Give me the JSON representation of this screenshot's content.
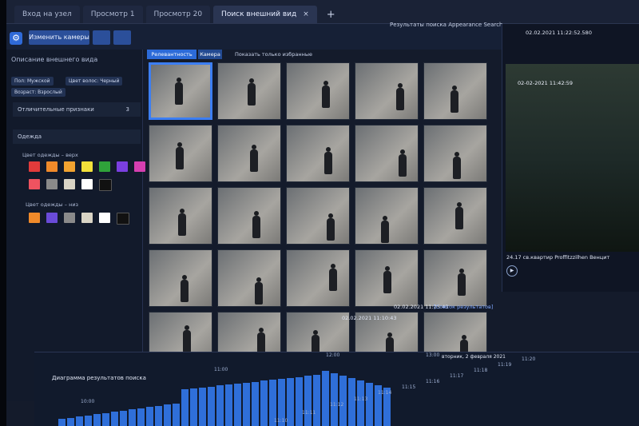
{
  "tabs": [
    {
      "label": "Вход на узел"
    },
    {
      "label": "Просмотр 1"
    },
    {
      "label": "Просмотр 20"
    },
    {
      "label": "Поиск внешний вид",
      "active": true
    }
  ],
  "tab_close": "×",
  "tab_add": "+",
  "toolbar": {
    "change_camera": "Изменить камеры"
  },
  "results_title": "Результаты поиска Appearance Search",
  "left": {
    "appearance_title": "Описание внешнего вида",
    "chips": [
      "Пол: Мужской",
      "Цвет волос: Черный",
      "Возраст: Взрослый"
    ],
    "distinct_features": "Отличительные признаки",
    "distinct_count": "3",
    "clothing": "Одежда",
    "top_color": "Цвет одежды – верх",
    "bottom_color": "Цвет одежды – низ",
    "top_colors": [
      "#e23b3b",
      "#f08a2a",
      "#f2a330",
      "#f2e03a",
      "#2fa33a",
      "#7a3fe0",
      "#d53fb0",
      "#ef5360",
      "#8a8a8a",
      "#d9d4c5",
      "#ffffff",
      "#111111"
    ],
    "bottom_colors": [
      "#f08a2a",
      "#6a4bd8",
      "#8a8a8a",
      "#d9d4c5",
      "#ffffff",
      "#111111"
    ]
  },
  "filters": {
    "relevance": "Релевантность",
    "camera": "Камера",
    "only_favorites": "Показать только избранные результаты"
  },
  "grid_labels": {
    "time": "02.02.2021 11:10:43",
    "time2": "02.02.2021 11:25:43",
    "results_link": "[Список результатов]"
  },
  "preview": {
    "timestamp": "02.02.2021 11:22:52.580",
    "overlay_ts": "02-02-2021 11:42:59",
    "caption": "24.17 св.квартир Proffitzzilhen Венцит"
  },
  "timeline": {
    "title": "Диаграмма результатов поиска",
    "ticks": [
      "10:00",
      "11:00",
      "12:00",
      "13:00",
      "11:10",
      "11:11",
      "11:12",
      "11:13",
      "11:14",
      "11:15",
      "11:16",
      "11:17",
      "11:18",
      "11:19",
      "11:20"
    ],
    "date_label": "вторник, 2 февраля 2021"
  }
}
